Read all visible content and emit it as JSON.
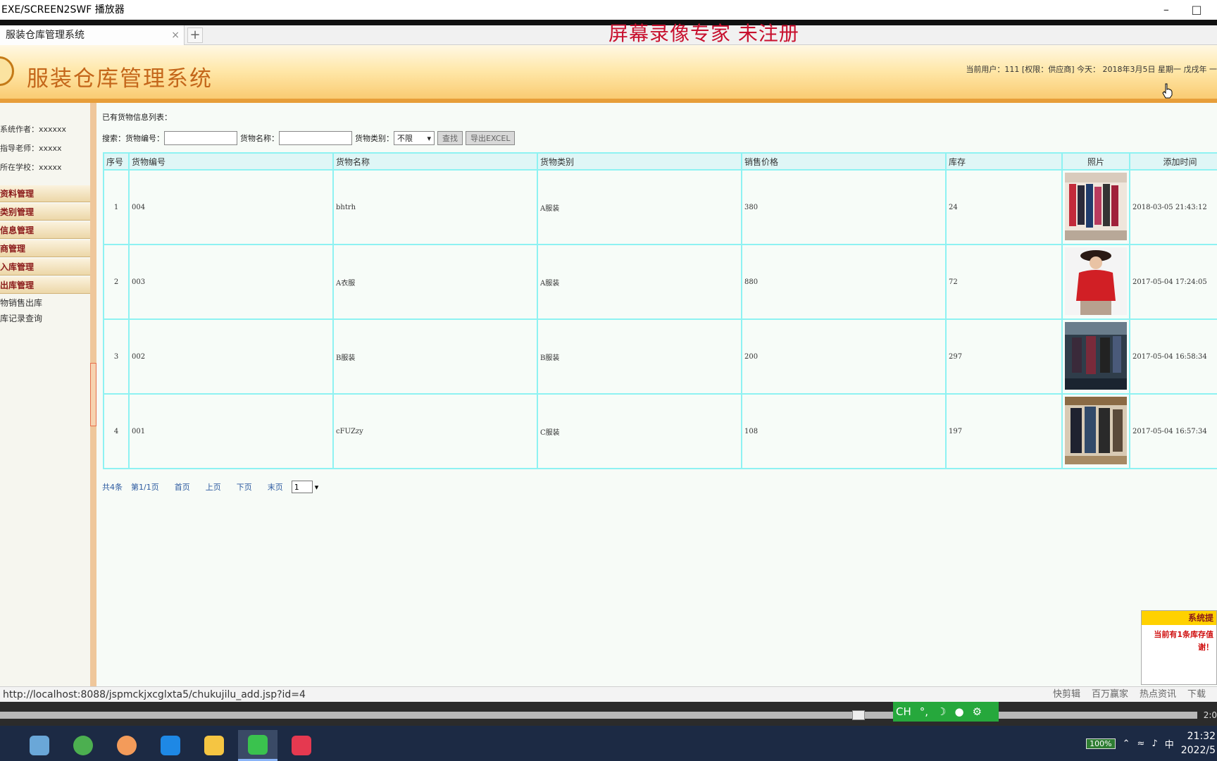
{
  "window": {
    "title": "EXE/SCREEN2SWF 播放器",
    "watermark": "屏幕录像专家  未注册"
  },
  "browser": {
    "tab_title": "服装仓库管理系统",
    "tab_close": "×",
    "new_tab": "+",
    "status_url": "http://localhost:8088/jspmckjxcglxta5/chukujilu_add.jsp?id=4",
    "tools": [
      "快剪辑",
      "百万赢家",
      "热点资讯",
      "下载"
    ]
  },
  "header": {
    "title": "服装仓库管理系统",
    "info": "当前用户：111 [权限：供应商] 今天： 2018年3月5日 星期一 戊戌年 一"
  },
  "sidebar": {
    "meta": [
      "系统作者：xxxxxx",
      "指导老师：xxxxx",
      "所在学校：xxxxx"
    ],
    "menu": [
      "资料管理",
      "类别管理",
      "信息管理",
      "商管理",
      "入库管理",
      "出库管理"
    ],
    "submenu": [
      "物销售出库",
      "库记录查询"
    ]
  },
  "main": {
    "list_title": "已有货物信息列表：",
    "search": {
      "label": "搜索：",
      "code_label": "货物编号：",
      "name_label": "货物名称：",
      "category_label": "货物类别：",
      "category_value": "不限",
      "find_btn": "查找",
      "export_btn": "导出EXCEL"
    },
    "columns": [
      "序号",
      "货物编号",
      "货物名称",
      "货物类别",
      "销售价格",
      "库存",
      "照片",
      "添加时间"
    ],
    "rows": [
      {
        "no": "1",
        "code": "004",
        "name": "bhtrh",
        "category": "A服装",
        "price": "380",
        "stock": "24",
        "time": "2018-03-05 21:43:12"
      },
      {
        "no": "2",
        "code": "003",
        "name": "A衣服",
        "category": "A服装",
        "price": "880",
        "stock": "72",
        "time": "2017-05-04 17:24:05"
      },
      {
        "no": "3",
        "code": "002",
        "name": "B服装",
        "category": "B服装",
        "price": "200",
        "stock": "297",
        "time": "2017-05-04 16:58:34"
      },
      {
        "no": "4",
        "code": "001",
        "name": "cFUZzy",
        "category": "C服装",
        "price": "108",
        "stock": "197",
        "time": "2017-05-04 16:57:34"
      }
    ],
    "pager": {
      "total": "共4条",
      "page": "第1/1页",
      "first": "首页",
      "prev": "上页",
      "next": "下页",
      "last": "末页",
      "select": "1"
    }
  },
  "notice": {
    "title": "系统提",
    "body": "当前有1条库存值 谢！"
  },
  "player": {
    "ime": "CH",
    "timecode": "2:0"
  },
  "taskbar": {
    "battery": "100%",
    "ime_char": "中",
    "time": "21:32",
    "date": "2022/5"
  }
}
